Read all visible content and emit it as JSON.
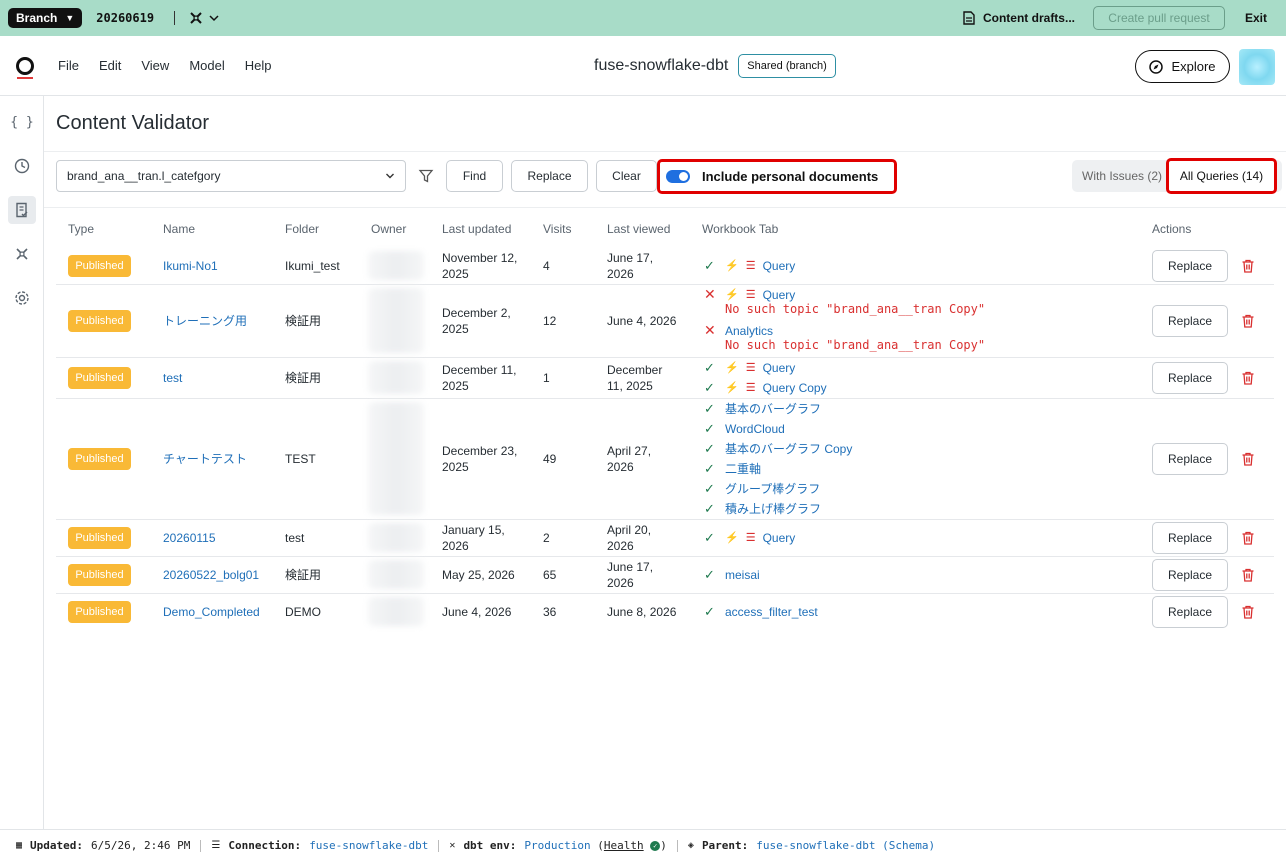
{
  "branchbar": {
    "branch_label": "Branch",
    "branch_name": "20260619",
    "drafts_label": "Content drafts...",
    "create_pr_label": "Create pull request",
    "exit_label": "Exit"
  },
  "header": {
    "menu": [
      "File",
      "Edit",
      "View",
      "Model",
      "Help"
    ],
    "project_title": "fuse-snowflake-dbt",
    "shared_label": "Shared (branch)",
    "explore_label": "Explore"
  },
  "page": {
    "title": "Content Validator",
    "select_value": "brand_ana__tran.l_catefgory",
    "find_label": "Find",
    "replace_label": "Replace",
    "clear_label": "Clear",
    "include_personal_label": "Include personal documents",
    "include_personal_on": true,
    "with_issues_label": "With Issues (2)",
    "all_queries_label": "All Queries (14)"
  },
  "table": {
    "headers": [
      "Type",
      "Name",
      "Folder",
      "Owner",
      "Last updated",
      "Visits",
      "Last viewed",
      "Workbook Tab",
      "Actions"
    ],
    "replace_label": "Replace",
    "rows": [
      {
        "type": "Published",
        "name": "Ikumi-No1",
        "folder": "Ikumi_test",
        "updated_1": "November 12,",
        "updated_2": "2025",
        "visits": "4",
        "viewed_1": "June 17,",
        "viewed_2": "2026",
        "tabs": [
          {
            "label": "Query",
            "status": "ok",
            "query": true
          }
        ]
      },
      {
        "type": "Published",
        "name": "トレーニング用",
        "folder": "検証用",
        "updated_1": "December 2,",
        "updated_2": "2025",
        "visits": "12",
        "viewed_1": "June 4, 2026",
        "viewed_2": "",
        "tabs": [
          {
            "label": "Query",
            "status": "error",
            "query": true,
            "error": "No such topic \"brand_ana__tran Copy\""
          },
          {
            "label": "Analytics",
            "status": "error",
            "query": false,
            "error": "No such topic \"brand_ana__tran Copy\""
          }
        ]
      },
      {
        "type": "Published",
        "name": "test",
        "folder": "検証用",
        "updated_1": "December 11,",
        "updated_2": "2025",
        "visits": "1",
        "viewed_1": "December",
        "viewed_2": "11, 2025",
        "tabs": [
          {
            "label": "Query",
            "status": "ok",
            "query": true
          },
          {
            "label": "Query Copy",
            "status": "ok",
            "query": true
          }
        ]
      },
      {
        "type": "Published",
        "name": "チャートテスト",
        "folder": "TEST",
        "updated_1": "December 23,",
        "updated_2": "2025",
        "visits": "49",
        "viewed_1": "April 27,",
        "viewed_2": "2026",
        "tabs": [
          {
            "label": "基本のバーグラフ",
            "status": "ok",
            "query": false
          },
          {
            "label": "WordCloud",
            "status": "ok",
            "query": false
          },
          {
            "label": "基本のバーグラフ Copy",
            "status": "ok",
            "query": false
          },
          {
            "label": "二重軸",
            "status": "ok",
            "query": false
          },
          {
            "label": "グループ棒グラフ",
            "status": "ok",
            "query": false
          },
          {
            "label": "積み上げ棒グラフ",
            "status": "ok",
            "query": false
          }
        ]
      },
      {
        "type": "Published",
        "name": "20260115",
        "folder": "test",
        "updated_1": "January 15,",
        "updated_2": "2026",
        "visits": "2",
        "viewed_1": "April 20,",
        "viewed_2": "2026",
        "tabs": [
          {
            "label": "Query",
            "status": "ok",
            "query": true
          }
        ]
      },
      {
        "type": "Published",
        "name": "20260522_bolg01",
        "folder": "検証用",
        "updated_1": "May 25, 2026",
        "updated_2": "",
        "visits": "65",
        "viewed_1": "June 17,",
        "viewed_2": "2026",
        "tabs": [
          {
            "label": "meisai",
            "status": "ok",
            "query": false
          }
        ]
      },
      {
        "type": "Published",
        "name": "Demo_Completed",
        "folder": "DEMO",
        "updated_1": "June 4, 2026",
        "updated_2": "",
        "visits": "36",
        "viewed_1": "June 8, 2026",
        "viewed_2": "",
        "tabs": [
          {
            "label": "access_filter_test",
            "status": "ok",
            "query": false
          }
        ]
      }
    ]
  },
  "statusbar": {
    "updated_label": "Updated:",
    "updated_value": "6/5/26, 2:46 PM",
    "connection_label": "Connection:",
    "connection_value": "fuse-snowflake-dbt",
    "env_label": "dbt env:",
    "env_value": "Production",
    "health_label": "Health",
    "parent_label": "Parent:",
    "parent_value": "fuse-snowflake-dbt (Schema)"
  },
  "colors": {
    "branchbar_bg": "#a8dcc8",
    "badge": "#f9b936",
    "link": "#1f6fb8",
    "error": "#d93030",
    "ok": "#1f7a4f",
    "highlight_box": "#e00000"
  }
}
